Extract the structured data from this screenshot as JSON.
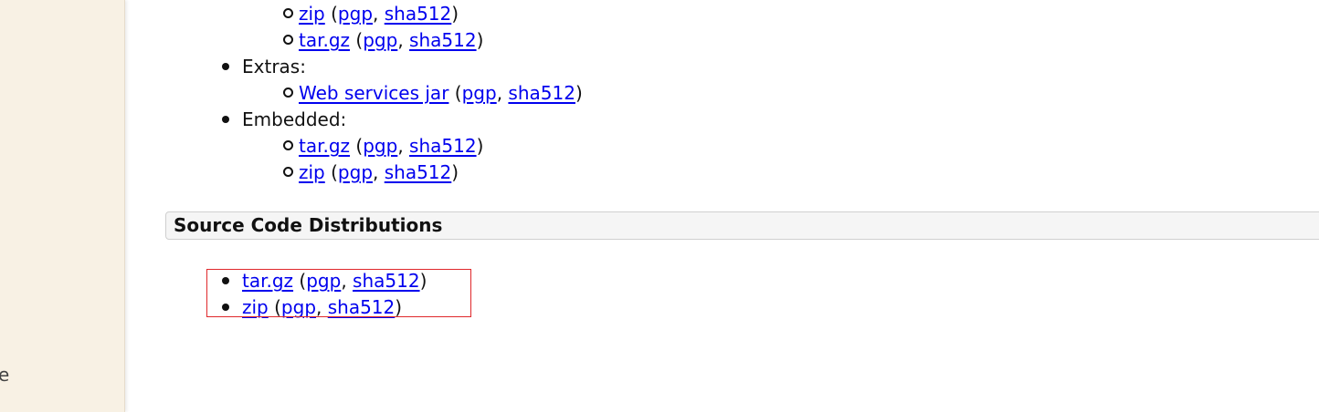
{
  "sidebar": {
    "fragment_text": "e"
  },
  "downloads": {
    "binary_items": [
      {
        "name": "zip",
        "pgp": "pgp",
        "hash": "sha512"
      },
      {
        "name": "tar.gz",
        "pgp": "pgp",
        "hash": "sha512"
      }
    ],
    "extras": {
      "label": "Extras:",
      "items": [
        {
          "name": "Web services jar",
          "pgp": "pgp",
          "hash": "sha512"
        }
      ]
    },
    "embedded": {
      "label": "Embedded:",
      "items": [
        {
          "name": "tar.gz",
          "pgp": "pgp",
          "hash": "sha512"
        },
        {
          "name": "zip",
          "pgp": "pgp",
          "hash": "sha512"
        }
      ]
    }
  },
  "source": {
    "header": "Source Code Distributions",
    "items": [
      {
        "name": "tar.gz",
        "pgp": "pgp",
        "hash": "sha512"
      },
      {
        "name": "zip",
        "pgp": "pgp",
        "hash": "sha512"
      }
    ]
  },
  "punct": {
    "open": " (",
    "sep": ", ",
    "close": ")"
  },
  "colors": {
    "link": "#0000ee",
    "sidebar_bg": "#f8f1e4",
    "highlight": "#e0282b"
  }
}
